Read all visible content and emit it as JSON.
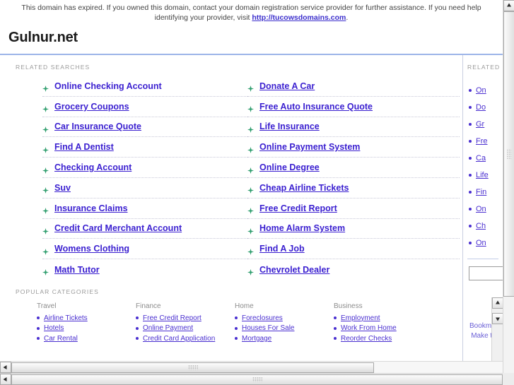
{
  "banner": {
    "text_before": "This domain has expired. If you owned this domain, contact your domain registration service provider for further assistance. If you need help identifying your provider, visit ",
    "link_text": "http://tucowsdomains.com",
    "text_after": "."
  },
  "header": {
    "site_title": "Gulnur.net"
  },
  "main": {
    "related_label": "RELATED SEARCHES",
    "popular_label": "POPULAR CATEGORIES",
    "related_searches": {
      "column1": [
        "Online Checking Account",
        "Grocery Coupons",
        "Car Insurance Quote",
        "Find A Dentist",
        "Checking Account",
        "Suv",
        "Insurance Claims",
        "Credit Card Merchant Account",
        "Womens Clothing",
        "Math Tutor"
      ],
      "column2": [
        "Donate A Car",
        "Free Auto Insurance Quote",
        "Life Insurance",
        "Online Payment System",
        "Online Degree",
        "Cheap Airline Tickets",
        "Free Credit Report",
        "Home Alarm System",
        "Find A Job",
        "Chevrolet Dealer"
      ]
    },
    "popular_categories": [
      {
        "heading": "Travel",
        "items": [
          "Airline Tickets",
          "Hotels",
          "Car Rental"
        ]
      },
      {
        "heading": "Finance",
        "items": [
          "Free Credit Report",
          "Online Payment",
          "Credit Card Application"
        ]
      },
      {
        "heading": "Home",
        "items": [
          "Foreclosures",
          "Houses For Sale",
          "Mortgage"
        ]
      },
      {
        "heading": "Business",
        "items": [
          "Employment",
          "Work From Home",
          "Reorder Checks"
        ]
      }
    ]
  },
  "sidebar": {
    "related_label": "RELATED",
    "items": [
      "On",
      "Do",
      "Gr",
      "Fre",
      "Ca",
      "Life",
      "Fin",
      "On",
      "Ch",
      "On"
    ],
    "search_value": "",
    "bookmark_link": "Bookmark",
    "makehome_link": "Make this"
  },
  "colors": {
    "link": "#3a1fd0",
    "bullet": "#2f9e6e",
    "rule": "#9db4e8",
    "muted": "#9a9a9a"
  },
  "icons": {
    "arrow_bullet": "arrow-bullet-icon",
    "dot_bullet": "dot-bullet-icon"
  }
}
